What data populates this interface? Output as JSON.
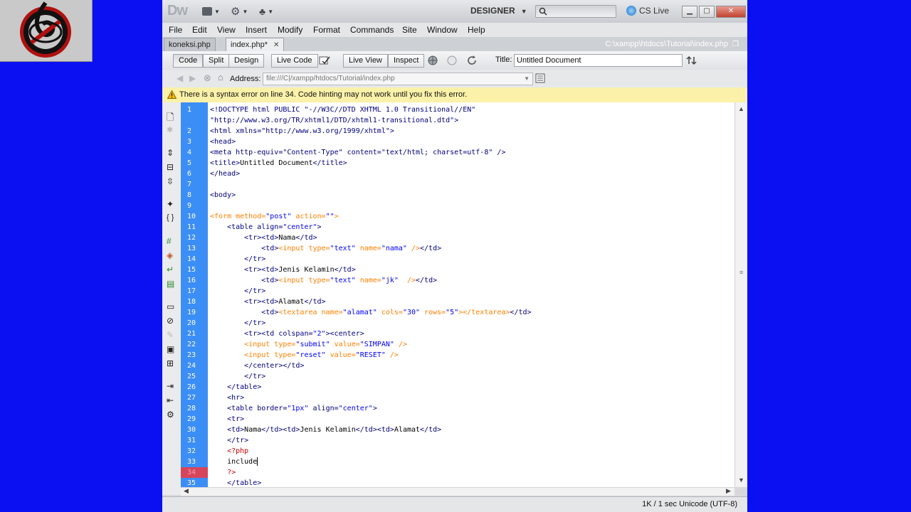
{
  "titlebar": {
    "logo": "Dw",
    "workspace": "DESIGNER",
    "cslive": "CS Live"
  },
  "menu": [
    "File",
    "Edit",
    "View",
    "Insert",
    "Modify",
    "Format",
    "Commands",
    "Site",
    "Window",
    "Help"
  ],
  "tabs": [
    {
      "label": "koneksi.php"
    },
    {
      "label": "index.php*",
      "close": "✕"
    }
  ],
  "file_path": "C:\\xampp\\htdocs\\Tutorial\\index.php",
  "doc_toolbar": {
    "code": "Code",
    "split": "Split",
    "design": "Design",
    "live_code": "Live Code",
    "live_view": "Live View",
    "inspect": "Inspect",
    "title_label": "Title:",
    "title_value": "Untitled Document"
  },
  "address": {
    "label": "Address:",
    "value": "file:///C|/xampp/htdocs/Tutorial/index.php"
  },
  "error_message": "There is a syntax error on line 34.  Code hinting may not work until you fix this error.",
  "status": "1K / 1 sec  Unicode (UTF-8)",
  "code_lines": [
    {
      "n": "1",
      "segs": [
        {
          "t": "<!DOCTYPE html PUBLIC \"-//W3C//DTD XHTML 1.0 Transitional//EN\"",
          "c": "tag"
        }
      ]
    },
    {
      "n": "",
      "segs": [
        {
          "t": "\"http://www.w3.org/TR/xhtml1/DTD/xhtml1-transitional.dtd\">",
          "c": "tag"
        }
      ]
    },
    {
      "n": "2",
      "segs": [
        {
          "t": "<html xmlns=\"http://www.w3.org/1999/xhtml\">",
          "c": "tag"
        }
      ]
    },
    {
      "n": "3",
      "segs": [
        {
          "t": "<head>",
          "c": "tag"
        }
      ]
    },
    {
      "n": "4",
      "segs": [
        {
          "t": "<meta http-equiv=\"Content-Type\" content=\"text/html; charset=utf-8\" />",
          "c": "tag"
        }
      ]
    },
    {
      "n": "5",
      "segs": [
        {
          "t": "<title>",
          "c": "tag"
        },
        {
          "t": "Untitled Document",
          "c": "txt"
        },
        {
          "t": "</title>",
          "c": "tag"
        }
      ]
    },
    {
      "n": "6",
      "segs": [
        {
          "t": "</head>",
          "c": "tag"
        }
      ]
    },
    {
      "n": "7",
      "segs": []
    },
    {
      "n": "8",
      "segs": [
        {
          "t": "<body>",
          "c": "tag"
        }
      ]
    },
    {
      "n": "9",
      "segs": []
    },
    {
      "n": "10",
      "segs": [
        {
          "t": "<form method=",
          "c": "form"
        },
        {
          "t": "\"post\"",
          "c": "str"
        },
        {
          "t": " action=",
          "c": "form"
        },
        {
          "t": "\"\"",
          "c": "str"
        },
        {
          "t": ">",
          "c": "form"
        }
      ]
    },
    {
      "n": "11",
      "segs": [
        {
          "t": "    <table align=",
          "c": "tag"
        },
        {
          "t": "\"center\"",
          "c": "str"
        },
        {
          "t": ">",
          "c": "tag"
        }
      ]
    },
    {
      "n": "12",
      "segs": [
        {
          "t": "        <tr><td>",
          "c": "tag"
        },
        {
          "t": "Nama",
          "c": "txt"
        },
        {
          "t": "</td>",
          "c": "tag"
        }
      ]
    },
    {
      "n": "13",
      "segs": [
        {
          "t": "            <td>",
          "c": "tag"
        },
        {
          "t": "<input type=",
          "c": "form"
        },
        {
          "t": "\"text\"",
          "c": "str"
        },
        {
          "t": " name=",
          "c": "form"
        },
        {
          "t": "\"nama\"",
          "c": "str"
        },
        {
          "t": " />",
          "c": "form"
        },
        {
          "t": "</td>",
          "c": "tag"
        }
      ]
    },
    {
      "n": "14",
      "segs": [
        {
          "t": "        </tr>",
          "c": "tag"
        }
      ]
    },
    {
      "n": "15",
      "segs": [
        {
          "t": "        <tr><td>",
          "c": "tag"
        },
        {
          "t": "Jenis Kelamin",
          "c": "txt"
        },
        {
          "t": "</td>",
          "c": "tag"
        }
      ]
    },
    {
      "n": "16",
      "segs": [
        {
          "t": "            <td>",
          "c": "tag"
        },
        {
          "t": "<input type=",
          "c": "form"
        },
        {
          "t": "\"text\"",
          "c": "str"
        },
        {
          "t": " name=",
          "c": "form"
        },
        {
          "t": "\"jk\"",
          "c": "str"
        },
        {
          "t": "  />",
          "c": "form"
        },
        {
          "t": "</td>",
          "c": "tag"
        }
      ]
    },
    {
      "n": "17",
      "segs": [
        {
          "t": "        </tr>",
          "c": "tag"
        }
      ]
    },
    {
      "n": "18",
      "segs": [
        {
          "t": "        <tr><td>",
          "c": "tag"
        },
        {
          "t": "Alamat",
          "c": "txt"
        },
        {
          "t": "</td>",
          "c": "tag"
        }
      ]
    },
    {
      "n": "19",
      "segs": [
        {
          "t": "            <td>",
          "c": "tag"
        },
        {
          "t": "<textarea name=",
          "c": "form"
        },
        {
          "t": "\"alamat\"",
          "c": "str"
        },
        {
          "t": " cols=",
          "c": "form"
        },
        {
          "t": "\"30\"",
          "c": "str"
        },
        {
          "t": " rows=",
          "c": "form"
        },
        {
          "t": "\"5\"",
          "c": "str"
        },
        {
          "t": "></textarea>",
          "c": "form"
        },
        {
          "t": "</td>",
          "c": "tag"
        }
      ]
    },
    {
      "n": "20",
      "segs": [
        {
          "t": "        </tr>",
          "c": "tag"
        }
      ]
    },
    {
      "n": "21",
      "segs": [
        {
          "t": "        <tr><td colspan=",
          "c": "tag"
        },
        {
          "t": "\"2\"",
          "c": "str"
        },
        {
          "t": "><center>",
          "c": "tag"
        }
      ]
    },
    {
      "n": "22",
      "segs": [
        {
          "t": "        <input type=",
          "c": "form"
        },
        {
          "t": "\"submit\"",
          "c": "str"
        },
        {
          "t": " value=",
          "c": "form"
        },
        {
          "t": "\"SIMPAN\"",
          "c": "str"
        },
        {
          "t": " />",
          "c": "form"
        }
      ]
    },
    {
      "n": "23",
      "segs": [
        {
          "t": "        <input type=",
          "c": "form"
        },
        {
          "t": "\"reset\"",
          "c": "str"
        },
        {
          "t": " value=",
          "c": "form"
        },
        {
          "t": "\"RESET\"",
          "c": "str"
        },
        {
          "t": " />",
          "c": "form"
        }
      ]
    },
    {
      "n": "24",
      "segs": [
        {
          "t": "        </center></td>",
          "c": "tag"
        }
      ]
    },
    {
      "n": "25",
      "segs": [
        {
          "t": "        </tr>",
          "c": "tag"
        }
      ]
    },
    {
      "n": "26",
      "segs": [
        {
          "t": "    </table>",
          "c": "tag"
        }
      ]
    },
    {
      "n": "27",
      "segs": [
        {
          "t": "    <hr>",
          "c": "tag"
        }
      ]
    },
    {
      "n": "28",
      "segs": [
        {
          "t": "    <table border=",
          "c": "tag"
        },
        {
          "t": "\"1px\"",
          "c": "str"
        },
        {
          "t": " align=",
          "c": "tag"
        },
        {
          "t": "\"center\"",
          "c": "str"
        },
        {
          "t": ">",
          "c": "tag"
        }
      ]
    },
    {
      "n": "29",
      "segs": [
        {
          "t": "    <tr>",
          "c": "tag"
        }
      ]
    },
    {
      "n": "30",
      "segs": [
        {
          "t": "    <td>",
          "c": "tag"
        },
        {
          "t": "Nama",
          "c": "txt"
        },
        {
          "t": "</td><td>",
          "c": "tag"
        },
        {
          "t": "Jenis Kelamin",
          "c": "txt"
        },
        {
          "t": "</td><td>",
          "c": "tag"
        },
        {
          "t": "Alamat",
          "c": "txt"
        },
        {
          "t": "</td>",
          "c": "tag"
        }
      ]
    },
    {
      "n": "31",
      "segs": [
        {
          "t": "    </tr>",
          "c": "tag"
        }
      ]
    },
    {
      "n": "32",
      "segs": [
        {
          "t": "    <?php",
          "c": "php"
        }
      ]
    },
    {
      "n": "33",
      "segs": [
        {
          "t": "    include",
          "c": "txt"
        }
      ],
      "cursor": true
    },
    {
      "n": "34",
      "segs": [
        {
          "t": "    ?>",
          "c": "php"
        }
      ],
      "error": true
    },
    {
      "n": "35",
      "segs": [
        {
          "t": "    </table>",
          "c": "tag"
        }
      ]
    }
  ],
  "colors": {
    "desktop": "#0b10f2",
    "gutter": "#3c8ef7",
    "error_line": "#d6455c",
    "error_bar": "#fbf1a9",
    "tag": "#000080",
    "form_tag": "#ff8000",
    "string": "#0000ff",
    "php": "#cc0000"
  },
  "icons": [
    "logo-emblem",
    "layout-icon",
    "gear-icon",
    "site-icon",
    "search-icon",
    "cs-live-icon",
    "minimize-icon",
    "maximize-icon",
    "close-icon",
    "warning-icon",
    "back-icon",
    "forward-icon",
    "stop-icon",
    "home-icon",
    "refresh-icon",
    "globe-icon",
    "validate-icon",
    "file-mgmt-icon"
  ]
}
